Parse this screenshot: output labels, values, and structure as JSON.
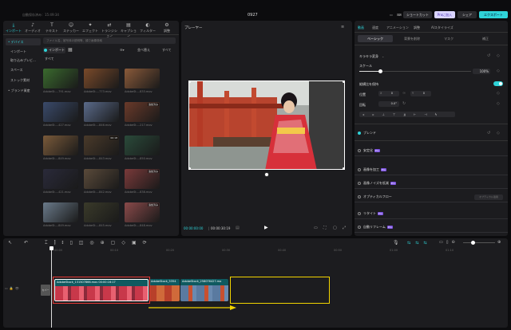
{
  "titlebar": {
    "saved": "自動保存済み：15:49:34",
    "project": "0927",
    "shortcut": "ショートカット",
    "pro": "Proに加入",
    "share": "シェア",
    "export": "エクスポート"
  },
  "media": {
    "tabs": [
      {
        "label": "インポート",
        "icon": "import-icon"
      },
      {
        "label": "オーディオ",
        "icon": "audio-icon"
      },
      {
        "label": "テキスト",
        "icon": "text-icon"
      },
      {
        "label": "ステッカー",
        "icon": "sticker-icon"
      },
      {
        "label": "エフェクト",
        "icon": "effects-icon"
      },
      {
        "label": "トランジション",
        "icon": "transition-icon"
      },
      {
        "label": "キャプション",
        "icon": "caption-icon"
      },
      {
        "label": "フィルター",
        "icon": "filter-icon"
      },
      {
        "label": "調整",
        "icon": "adjust-icon"
      }
    ],
    "sidebar": [
      "• デバイス",
      "インポート",
      "取り込みプレビ…",
      "スペース",
      "ストック素材",
      "• ブランド資産"
    ],
    "search_placeholder": "ファイル名、被写体の説明等、顔で画像検索",
    "import_btn": "インポート",
    "filter_btn": "並べ替え",
    "all_btn": "すべて",
    "section": "すべて",
    "clips": [
      {
        "name": "AdobeSt....791.mov",
        "badge": "",
        "color": "#3a6a2e"
      },
      {
        "name": "AdobeSt....773.mov",
        "badge": "",
        "color": "#7a4a2a"
      },
      {
        "name": "AdobeSt....833.mov",
        "badge": "",
        "color": "#8a5a3a"
      },
      {
        "name": "AdobeSt....427.mov",
        "badge": "",
        "color": "#3a4a6a"
      },
      {
        "name": "AdobeSt....846.mov",
        "badge": "",
        "color": "#5a6a8a"
      },
      {
        "name": "AdobeSt....217.mov",
        "badge": "追加済み",
        "color": "#6a3a2a"
      },
      {
        "name": "AdobeSt....849.mov",
        "badge": "",
        "color": "#7a5a3a"
      },
      {
        "name": "AdobeSt....843.mov",
        "badge": "00:18",
        "color": "#4a3a2a"
      },
      {
        "name": "AdobeSt....850.mov",
        "badge": "",
        "color": "#2a4a3a"
      },
      {
        "name": "AdobeSt....421.mov",
        "badge": "",
        "color": "#2a2a3a"
      },
      {
        "name": "AdobeSt....842.mov",
        "badge": "",
        "color": "#5a4a3a"
      },
      {
        "name": "AdobeSt....838.mov",
        "badge": "追加済み",
        "color": "#7a3a3a"
      },
      {
        "name": "AdobeSt....849.mov",
        "badge": "",
        "color": "#6a7a8a"
      },
      {
        "name": "AdobeSt....845.mov",
        "badge": "",
        "color": "#3a3a2a"
      },
      {
        "name": "AdobeSt....848.mov",
        "badge": "追加済み",
        "color": "#8a4a4a"
      }
    ]
  },
  "player": {
    "title": "プレーヤー",
    "current": "00:00:00:00",
    "total": "00:00:30:19"
  },
  "inspector": {
    "tabs": [
      "動画",
      "速度",
      "アニメーション",
      "調整",
      "AIスタイライズ"
    ],
    "subtabs": [
      "ベーシック",
      "背景を削除",
      "マスク",
      "補正"
    ],
    "rows": {
      "fx": "キラキラ変身",
      "scale": "スケール",
      "scale_val": "100%",
      "uniform": "縦横比を保持",
      "pos": "位置",
      "x": "X",
      "xv": "0",
      "y": "Y",
      "yv": "0",
      "rot": "回転",
      "rotv": "0.0°",
      "blend": "ブレンド",
      "stab": "安定化",
      "enhance": "画像を加工",
      "denoise": "画像ノイズを低減",
      "optical": "オプティカルフロー",
      "retime": "リタイト",
      "auto": "自動リフレーム",
      "pro": "Pro",
      "optical_btn": "オプティカル適用"
    }
  },
  "timeline": {
    "ticks": [
      "00:00",
      "00:10",
      "00:20",
      "00:30",
      "00:40",
      "00:50",
      "01:00",
      "01:10"
    ],
    "cover": "カバー",
    "clip1": "AdobeStock_131507866.mov  00:00:16:17",
    "clip2": "AdobeStock_5354",
    "clip3": "AdobeStock_258076427.mo"
  },
  "colors": {
    "accent": "#2fd3d8",
    "red_box": "#e53935",
    "yellow_box": "#f2d400",
    "clip_bg": "#0f5a60"
  }
}
